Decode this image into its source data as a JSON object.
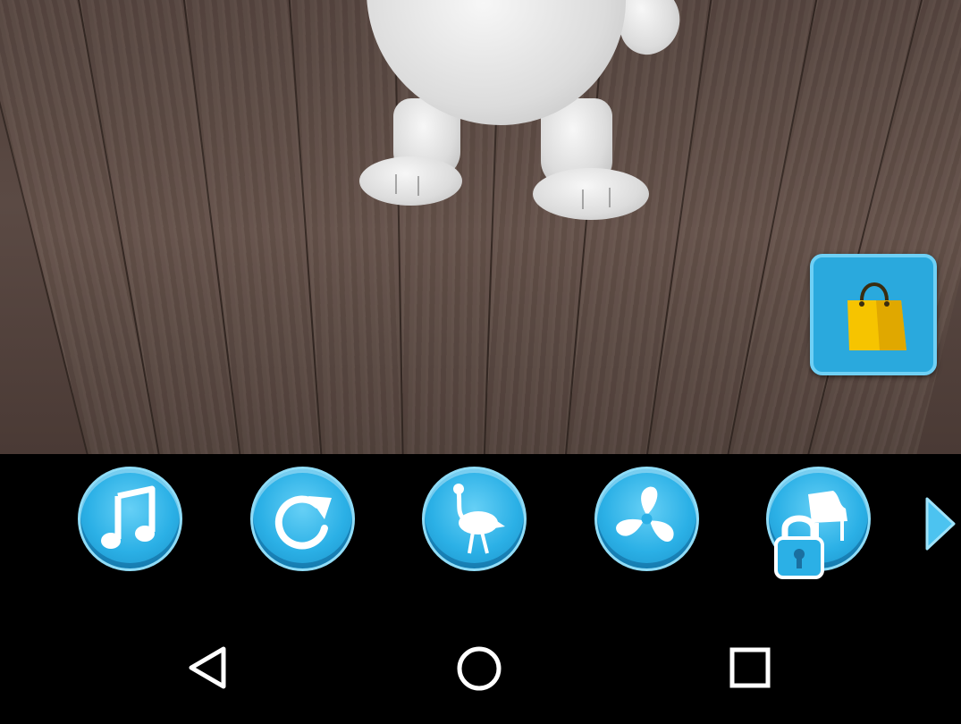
{
  "scene": {
    "floor_color": "#5a4842",
    "cat_fur_color": "#e8e8e8"
  },
  "shop": {
    "icon": "shopping-bag-icon",
    "bag_color": "#f6c400"
  },
  "toolbar": {
    "accent": "#2bb0e6",
    "buttons": [
      {
        "icon": "music-note-icon",
        "locked": false
      },
      {
        "icon": "redo-arrow-icon",
        "locked": false
      },
      {
        "icon": "ostrich-icon",
        "locked": false
      },
      {
        "icon": "fan-icon",
        "locked": false
      },
      {
        "icon": "piano-icon",
        "locked": true
      }
    ],
    "next_icon": "chevron-right-icon"
  },
  "navbar": {
    "back_icon": "back-triangle-icon",
    "home_icon": "home-circle-icon",
    "recents_icon": "recents-square-icon"
  }
}
